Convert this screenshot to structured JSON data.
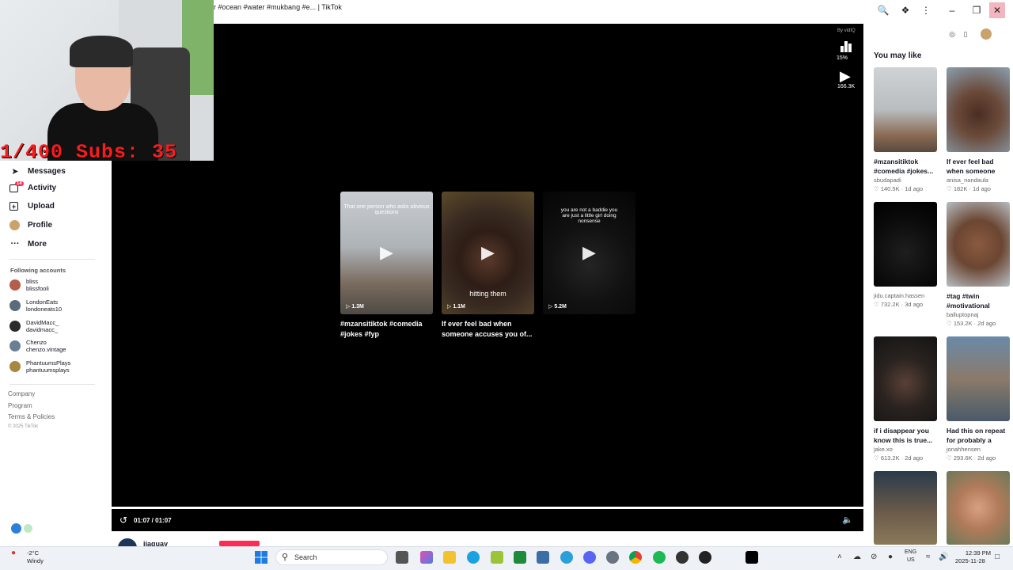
{
  "window": {
    "title": "r #ocean #water #mukbang #e... | TikTok"
  },
  "webcam": {
    "caption": "1/400  Subs: 35"
  },
  "sidebar": {
    "nav": [
      {
        "label": "Messages",
        "icon": "paper-plane-icon"
      },
      {
        "label": "Activity",
        "icon": "inbox-icon",
        "badge": "14"
      },
      {
        "label": "Upload",
        "icon": "plus-square-icon"
      },
      {
        "label": "Profile",
        "icon": "avatar"
      },
      {
        "label": "More",
        "icon": "more-dots-icon"
      }
    ],
    "following_title": "Following accounts",
    "accounts": [
      {
        "name": "bliss",
        "handle": "blissfooli"
      },
      {
        "name": "LondonEats",
        "handle": "londoneats10"
      },
      {
        "name": "DavidMacc_",
        "handle": "davidmacc_"
      },
      {
        "name": "Chenzo",
        "handle": "chenzo.vintage"
      },
      {
        "name": "PhantuumsPlays",
        "handle": "phantuumsplays"
      }
    ],
    "footer": [
      "Company",
      "Program",
      "Terms & Policies"
    ],
    "copyright": "© 2025 TikTok"
  },
  "video": {
    "byline": "By vidIQ",
    "stat_pct": "15%",
    "play_count": "166.3K",
    "time": "01:07 / 01:07",
    "cards": [
      {
        "views": "1.3M",
        "caption": "#mzansitiktok #comedia #jokes #fyp",
        "thumb_text": "That one person who asks obvious questions"
      },
      {
        "views": "1.1M",
        "caption": "If ever feel bad when someone accuses you of...",
        "thumb_text": "hitting them"
      },
      {
        "views": "5.2M",
        "caption": "",
        "thumb_text": "you are not a baddie you are just a little girl doing nonsense"
      }
    ],
    "author": "jiaquay"
  },
  "right_panel": {
    "title": "You may like",
    "items": [
      {
        "title": "#mzansitiktok #comedia #jokes...",
        "user": "sbudapadi",
        "likes": "140.5K",
        "ago": "1d ago"
      },
      {
        "title": "If ever feel bad when someone accuses...",
        "user": "anisa_nandaula",
        "likes": "182K",
        "ago": "1d ago"
      },
      {
        "title": "",
        "user": "jidu.captain.hassen",
        "likes": "732.2K",
        "ago": "3d ago"
      },
      {
        "title": "#tag #twin #motivational",
        "user": "balluptopnaj",
        "likes": "153.2K",
        "ago": "2d ago"
      },
      {
        "title": "if i disappear you know this is true...",
        "user": "jake.xo",
        "likes": "613.2K",
        "ago": "2d ago"
      },
      {
        "title": "Had this on repeat for probably a wee...",
        "user": "jonahhensen",
        "likes": "293.6K",
        "ago": "2d ago"
      },
      {
        "title": "",
        "user": "",
        "likes": "",
        "ago": ""
      },
      {
        "title": "",
        "user": "",
        "likes": "",
        "ago": ""
      }
    ]
  },
  "taskbar": {
    "temp": "-2°C",
    "condition": "Windy",
    "search_placeholder": "Search",
    "lang1": "ENG",
    "lang2": "US",
    "time": "12:39 PM",
    "date": "2025-11-28"
  },
  "colors": {
    "accent": "#fe2c55",
    "video_bg": "#000000"
  }
}
